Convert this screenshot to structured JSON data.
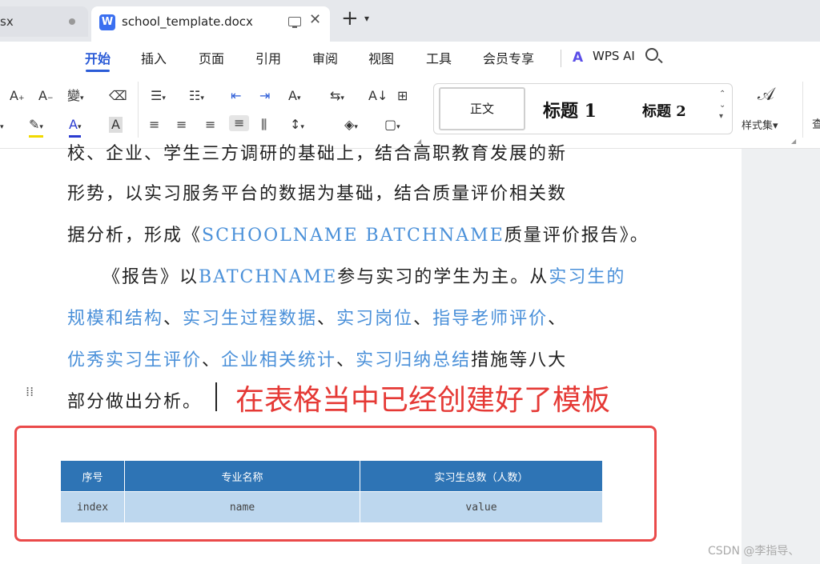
{
  "tabs": {
    "prev_tab_label": "sx",
    "active_tab_label": "school_template.docx",
    "app_logo_letter": "W",
    "new_tab_label": "+",
    "more_label": "⌄"
  },
  "menu": {
    "items": [
      "开始",
      "插入",
      "页面",
      "引用",
      "审阅",
      "视图",
      "工具",
      "会员专享"
    ],
    "active": "开始",
    "ai_label": "WPS AI"
  },
  "styles": {
    "normal": "正文",
    "heading1": "标题 1",
    "heading2": "标题 2",
    "style_set_label": "样式集",
    "cut_label": "查"
  },
  "document": {
    "line1": "校、企业、学生三方调研的基础上，结合高职教育发展的新",
    "line2": "形势，以实习服务平台的数据为基础，结合质量评价相关数",
    "line3_a": "据分析，形成《",
    "line3_link": "SCHOOLNAME BATCHNAME",
    "line3_b": "质量评价报告》。",
    "line4_a": "《报告》以",
    "line4_link1": "BATCHNAME",
    "line4_b": "参与实习的学生为主。从",
    "line4_link2": "实习生的",
    "line5_link1": "规模和结构",
    "line5_sep1": "、",
    "line5_link2": "实习生过程数据",
    "line5_sep2": "、",
    "line5_link3": "实习岗位",
    "line5_sep3": "、",
    "line5_link4": "指导老师评价",
    "line5_sep4": "、",
    "line6_link1": "优秀实习生评价",
    "line6_sep1": "、",
    "line6_link2": "企业相关统计",
    "line6_sep2": "、",
    "line6_link3": "实习归纳总结",
    "line6_b": "措施等八大",
    "line7": "部分做出分析。",
    "annotation": "在表格当中已经创建好了模板"
  },
  "template_table": {
    "headers": [
      "序号",
      "专业名称",
      "实习生总数（人数）"
    ],
    "row": [
      "index",
      "name",
      "value"
    ]
  },
  "watermark": "CSDN @李指导、",
  "colors": {
    "accent": "#2a5bd7",
    "link_text": "#4a90d9",
    "annotation_red": "#e53935",
    "table_header": "#2e74b5",
    "table_cell": "#bdd7ee"
  }
}
